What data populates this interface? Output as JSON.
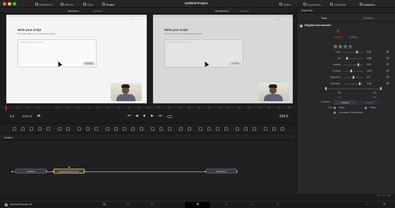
{
  "app": {
    "title": "Untitled Project",
    "name": "DaVinci Resolve 20"
  },
  "titlebar_tabs": [
    {
      "label": "MediaPool",
      "icon": "media-pool-icon"
    },
    {
      "label": "Effects",
      "icon": "effects-icon"
    },
    {
      "label": "Clips",
      "icon": "clips-icon"
    },
    {
      "label": "Nodes",
      "icon": "nodes-icon",
      "active": true
    },
    {
      "label": "Spline",
      "icon": "spline-icon"
    },
    {
      "label": "Keyframes",
      "icon": "keyframes-icon"
    },
    {
      "label": "Metadata",
      "icon": "metadata-icon"
    },
    {
      "label": "Inspector",
      "icon": "inspector-icon",
      "active": true
    }
  ],
  "viewers": {
    "left": {
      "name": "MediaIn1",
      "mode": "Default"
    },
    "right": {
      "name": "MediaOut1",
      "mode": "Default"
    }
  },
  "web_content": {
    "heading": "Write your script",
    "subheading": "Be concise. Make it conversational. Be helpful.",
    "placeholder": "Start writing your script here...",
    "button": "Generate"
  },
  "ruler_ticks": [
    "0",
    "10",
    "20",
    "30",
    "40",
    "50",
    "60",
    "70",
    "80",
    "90",
    "100",
    "110",
    "120",
    "130",
    "140",
    "150",
    "160",
    "170",
    "180",
    "190",
    "200",
    "210",
    "220",
    "230",
    "240",
    "250",
    "260",
    "270",
    "280"
  ],
  "transport": {
    "start": "0.0",
    "frame": "2271.0",
    "end": "150.0"
  },
  "nodes_panel": {
    "title": "Nodes",
    "nodes": [
      {
        "label": "MediaIn1"
      },
      {
        "label": "BrightnessContrast1",
        "selected": true
      },
      {
        "label": "MediaOut1"
      }
    ]
  },
  "inspector": {
    "title": "Inspector",
    "tools_tab": "Tools",
    "modifiers_tab": "Modifiers",
    "node_name": "BrightnessContrast1",
    "subtabs": [
      "Controls",
      "Settings"
    ],
    "channels": [
      "R",
      "G",
      "B",
      "A"
    ],
    "params": [
      {
        "label": "Gain",
        "value": "0.91"
      },
      {
        "label": "Lift",
        "value": "0.08"
      },
      {
        "label": "Gamma",
        "value": "0.97"
      },
      {
        "label": "Contrast",
        "value": "-0.27"
      },
      {
        "label": "Brightness",
        "value": "0.0"
      },
      {
        "label": "Saturation",
        "value": "1.19"
      }
    ],
    "range": {
      "low_value": "0.0",
      "high_value": "1.0",
      "low_label": "Low",
      "high_label": "High"
    },
    "direction": {
      "label": "Direction",
      "forward": "Forward",
      "reverse": "Reverse"
    },
    "clip": {
      "label": "Clip",
      "black": "Black",
      "white": "White"
    },
    "premultiply": "Pre-Divide / Post-Multiply"
  },
  "status": {
    "memory": "7.9% - 2777 MB"
  },
  "colors": {
    "accent_red": "#d44b40",
    "selection": "#c0a858",
    "active_tab": "#f0f0f0"
  }
}
